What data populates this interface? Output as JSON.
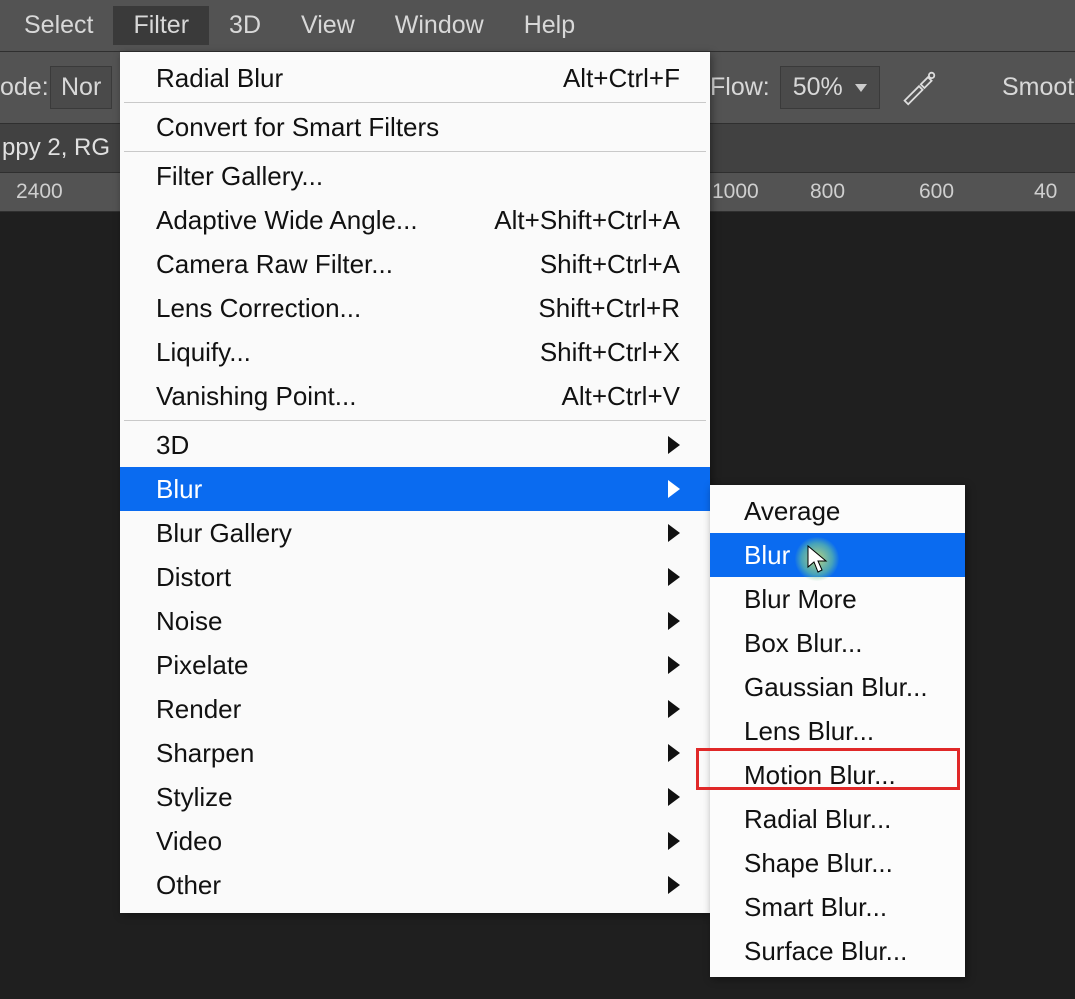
{
  "menubar": {
    "items": [
      "Select",
      "Filter",
      "3D",
      "View",
      "Window",
      "Help"
    ],
    "active_index": 1
  },
  "optionsbar": {
    "mode_label_fragment": "ode:",
    "mode_value_fragment": "Nor",
    "flow_label": "Flow:",
    "flow_value": "50%",
    "smoothing_label_fragment": "Smooth"
  },
  "tab_title_fragment": "ppy 2, RG",
  "ruler_ticks": [
    "2400",
    "1000",
    "800",
    "600",
    "40"
  ],
  "filter_menu": {
    "group0": [
      {
        "label": "Radial Blur",
        "shortcut": "Alt+Ctrl+F"
      }
    ],
    "group1": [
      {
        "label": "Convert for Smart Filters"
      }
    ],
    "group2": [
      {
        "label": "Filter Gallery..."
      },
      {
        "label": "Adaptive Wide Angle...",
        "shortcut": "Alt+Shift+Ctrl+A"
      },
      {
        "label": "Camera Raw Filter...",
        "shortcut": "Shift+Ctrl+A"
      },
      {
        "label": "Lens Correction...",
        "shortcut": "Shift+Ctrl+R"
      },
      {
        "label": "Liquify...",
        "shortcut": "Shift+Ctrl+X"
      },
      {
        "label": "Vanishing Point...",
        "shortcut": "Alt+Ctrl+V"
      }
    ],
    "group3": [
      {
        "label": "3D",
        "submenu": true
      },
      {
        "label": "Blur",
        "submenu": true,
        "highlighted": true
      },
      {
        "label": "Blur Gallery",
        "submenu": true
      },
      {
        "label": "Distort",
        "submenu": true
      },
      {
        "label": "Noise",
        "submenu": true
      },
      {
        "label": "Pixelate",
        "submenu": true
      },
      {
        "label": "Render",
        "submenu": true
      },
      {
        "label": "Sharpen",
        "submenu": true
      },
      {
        "label": "Stylize",
        "submenu": true
      },
      {
        "label": "Video",
        "submenu": true
      },
      {
        "label": "Other",
        "submenu": true
      }
    ]
  },
  "blur_submenu": {
    "items": [
      {
        "label": "Average"
      },
      {
        "label": "Blur",
        "highlighted": true
      },
      {
        "label": "Blur More"
      },
      {
        "label": "Box Blur..."
      },
      {
        "label": "Gaussian Blur..."
      },
      {
        "label": "Lens Blur..."
      },
      {
        "label": "Motion Blur...",
        "red_outline": true
      },
      {
        "label": "Radial Blur..."
      },
      {
        "label": "Shape Blur..."
      },
      {
        "label": "Smart Blur..."
      },
      {
        "label": "Surface Blur..."
      }
    ]
  }
}
